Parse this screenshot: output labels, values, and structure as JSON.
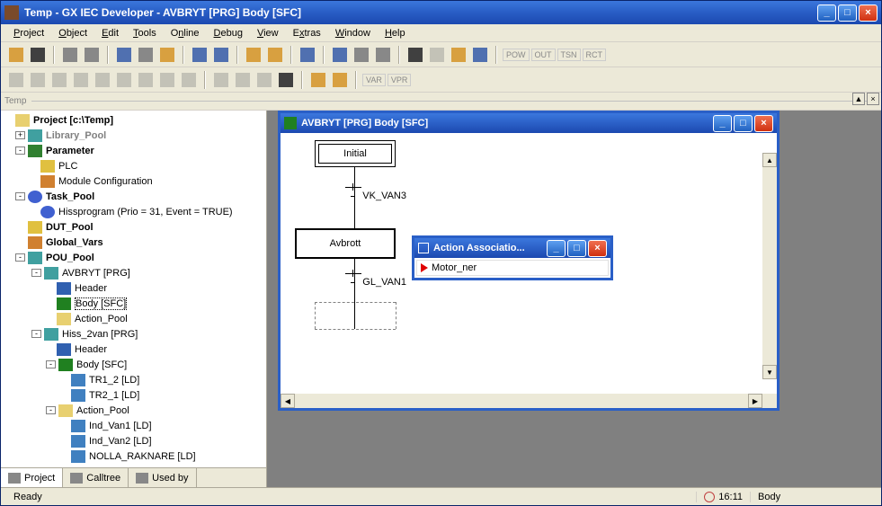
{
  "window": {
    "title": "Temp - GX IEC Developer - AVBRYT [PRG] Body [SFC]"
  },
  "menu": {
    "project": "Project",
    "object": "Object",
    "edit": "Edit",
    "tools": "Tools",
    "online": "Online",
    "debug": "Debug",
    "view": "View",
    "extras": "Extras",
    "window": "Window",
    "help": "Help"
  },
  "temp_label": "Temp",
  "project_tree": {
    "root": "Project [c:\\Temp]",
    "library_pool": "Library_Pool",
    "parameter": "Parameter",
    "plc": "PLC",
    "module_config": "Module Configuration",
    "task_pool": "Task_Pool",
    "hissprogram": "Hissprogram (Prio = 31, Event = TRUE)",
    "dut_pool": "DUT_Pool",
    "global_vars": "Global_Vars",
    "pou_pool": "POU_Pool",
    "avbryt": "AVBRYT [PRG]",
    "header": "Header",
    "body_sfc": "Body [SFC]",
    "action_pool": "Action_Pool",
    "hiss_2van": "Hiss_2van [PRG]",
    "header2": "Header",
    "body_sfc2": "Body [SFC]",
    "tr1_2": "TR1_2 [LD]",
    "tr2_1": "TR2_1 [LD]",
    "action_pool2": "Action_Pool",
    "ind_van1": "Ind_Van1 [LD]",
    "ind_van2": "Ind_Van2 [LD]",
    "nolla": "NOLLA_RAKNARE [LD]"
  },
  "sidebar_tabs": {
    "project": "Project",
    "calltree": "Calltree",
    "usedby": "Used by"
  },
  "child_window": {
    "title": "AVBRYT [PRG] Body [SFC]"
  },
  "sfc": {
    "initial": "Initial",
    "vk_van3": "VK_VAN3",
    "avbrott": "Avbrott",
    "gl_van1": "GL_VAN1"
  },
  "action_window": {
    "title": "Action Associatio...",
    "motor_ner": "Motor_ner"
  },
  "status": {
    "ready": "Ready",
    "time": "16:11",
    "body": "Body"
  },
  "toolbar_labels": {
    "pow": "POW",
    "out": "OUT",
    "tsn": "TSN",
    "rct": "RCT",
    "var": "VAR",
    "vpr": "VPR"
  }
}
